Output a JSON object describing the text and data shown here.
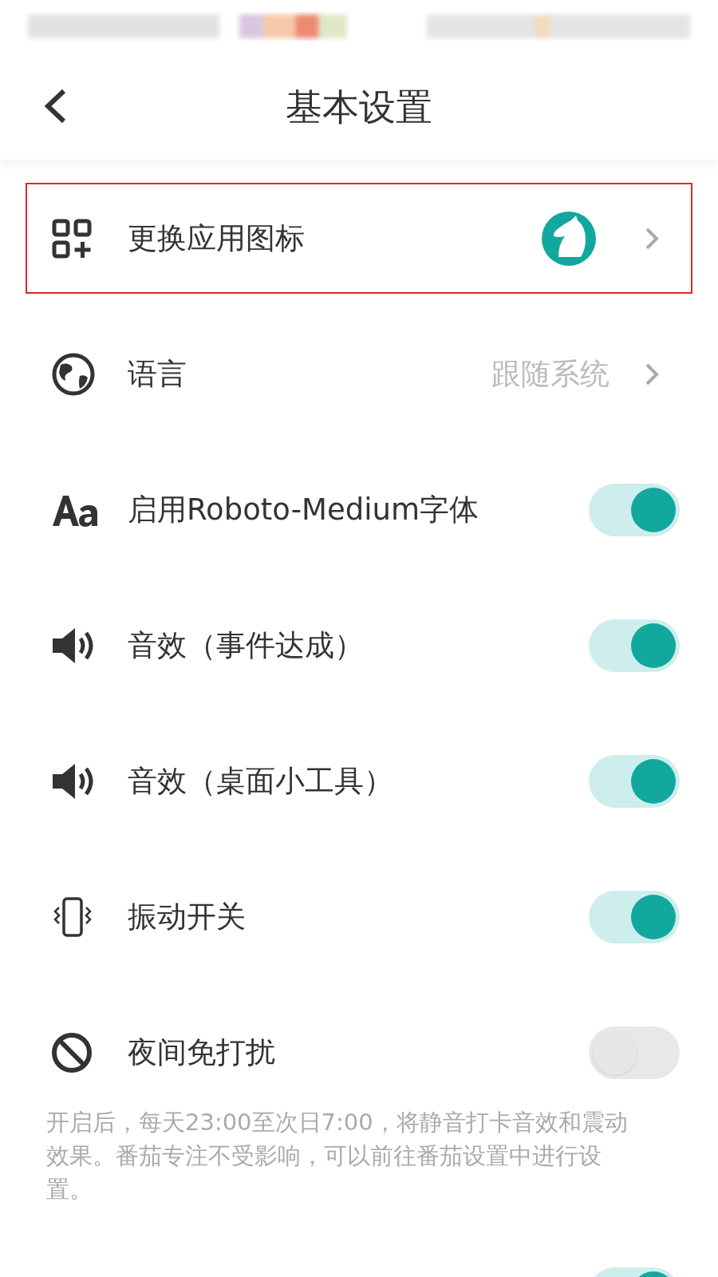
{
  "header": {
    "title": "基本设置"
  },
  "items": [
    {
      "kind": "link",
      "label": "更换应用图标",
      "highlighted": true,
      "avatar": true
    },
    {
      "kind": "link",
      "label": "语言",
      "value": "跟随系统",
      "highlighted": false
    },
    {
      "kind": "toggle",
      "label": "启用Roboto-Medium字体",
      "on": true
    },
    {
      "kind": "toggle",
      "label": "音效（事件达成）",
      "on": true
    },
    {
      "kind": "toggle",
      "label": "音效（桌面小工具）",
      "on": true
    },
    {
      "kind": "toggle",
      "label": "振动开关",
      "on": true
    },
    {
      "kind": "toggle",
      "label": "夜间免打扰",
      "on": false
    }
  ],
  "note": "开启后，每天23:00至次日7:00，将静音打卡音效和震动效果。番茄专注不受影响，可以前往番茄设置中进行设置。",
  "partial_toggle": {
    "on": true
  }
}
